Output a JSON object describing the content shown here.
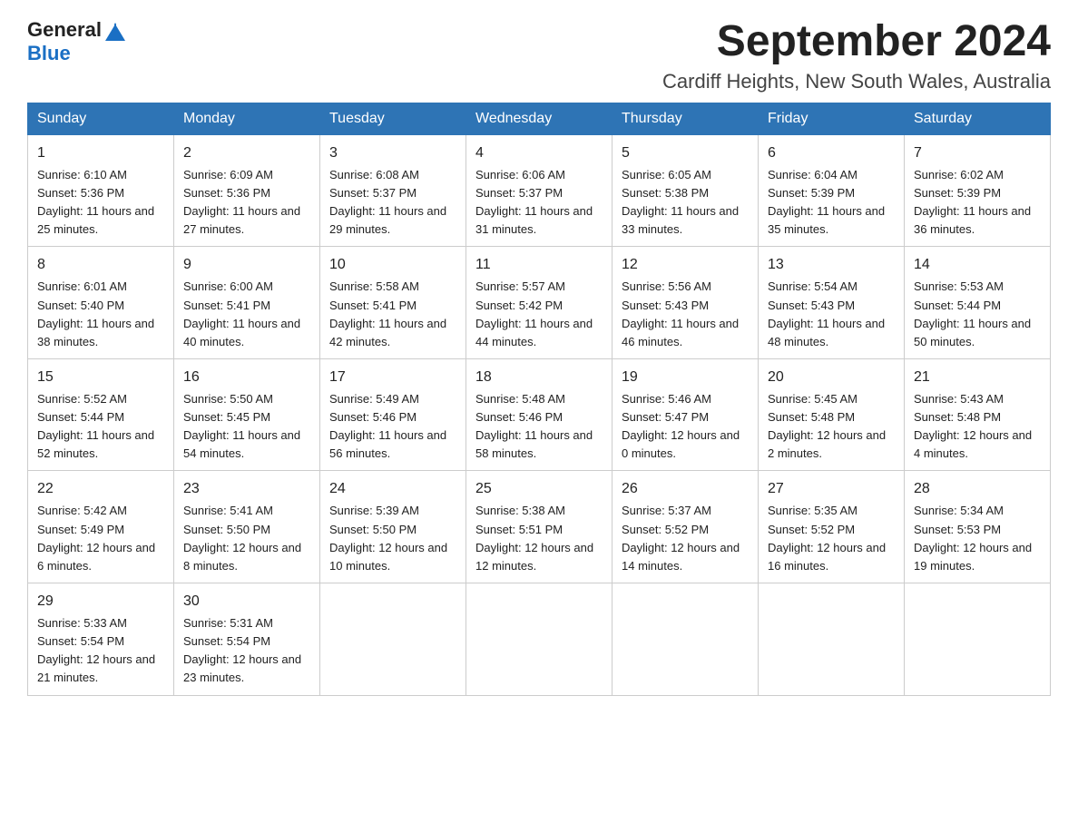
{
  "header": {
    "logo": {
      "general": "General",
      "blue": "Blue"
    },
    "month_title": "September 2024",
    "location": "Cardiff Heights, New South Wales, Australia"
  },
  "calendar": {
    "days_of_week": [
      "Sunday",
      "Monday",
      "Tuesday",
      "Wednesday",
      "Thursday",
      "Friday",
      "Saturday"
    ],
    "weeks": [
      [
        {
          "day": 1,
          "sunrise": "6:10 AM",
          "sunset": "5:36 PM",
          "daylight": "11 hours and 25 minutes."
        },
        {
          "day": 2,
          "sunrise": "6:09 AM",
          "sunset": "5:36 PM",
          "daylight": "11 hours and 27 minutes."
        },
        {
          "day": 3,
          "sunrise": "6:08 AM",
          "sunset": "5:37 PM",
          "daylight": "11 hours and 29 minutes."
        },
        {
          "day": 4,
          "sunrise": "6:06 AM",
          "sunset": "5:37 PM",
          "daylight": "11 hours and 31 minutes."
        },
        {
          "day": 5,
          "sunrise": "6:05 AM",
          "sunset": "5:38 PM",
          "daylight": "11 hours and 33 minutes."
        },
        {
          "day": 6,
          "sunrise": "6:04 AM",
          "sunset": "5:39 PM",
          "daylight": "11 hours and 35 minutes."
        },
        {
          "day": 7,
          "sunrise": "6:02 AM",
          "sunset": "5:39 PM",
          "daylight": "11 hours and 36 minutes."
        }
      ],
      [
        {
          "day": 8,
          "sunrise": "6:01 AM",
          "sunset": "5:40 PM",
          "daylight": "11 hours and 38 minutes."
        },
        {
          "day": 9,
          "sunrise": "6:00 AM",
          "sunset": "5:41 PM",
          "daylight": "11 hours and 40 minutes."
        },
        {
          "day": 10,
          "sunrise": "5:58 AM",
          "sunset": "5:41 PM",
          "daylight": "11 hours and 42 minutes."
        },
        {
          "day": 11,
          "sunrise": "5:57 AM",
          "sunset": "5:42 PM",
          "daylight": "11 hours and 44 minutes."
        },
        {
          "day": 12,
          "sunrise": "5:56 AM",
          "sunset": "5:43 PM",
          "daylight": "11 hours and 46 minutes."
        },
        {
          "day": 13,
          "sunrise": "5:54 AM",
          "sunset": "5:43 PM",
          "daylight": "11 hours and 48 minutes."
        },
        {
          "day": 14,
          "sunrise": "5:53 AM",
          "sunset": "5:44 PM",
          "daylight": "11 hours and 50 minutes."
        }
      ],
      [
        {
          "day": 15,
          "sunrise": "5:52 AM",
          "sunset": "5:44 PM",
          "daylight": "11 hours and 52 minutes."
        },
        {
          "day": 16,
          "sunrise": "5:50 AM",
          "sunset": "5:45 PM",
          "daylight": "11 hours and 54 minutes."
        },
        {
          "day": 17,
          "sunrise": "5:49 AM",
          "sunset": "5:46 PM",
          "daylight": "11 hours and 56 minutes."
        },
        {
          "day": 18,
          "sunrise": "5:48 AM",
          "sunset": "5:46 PM",
          "daylight": "11 hours and 58 minutes."
        },
        {
          "day": 19,
          "sunrise": "5:46 AM",
          "sunset": "5:47 PM",
          "daylight": "12 hours and 0 minutes."
        },
        {
          "day": 20,
          "sunrise": "5:45 AM",
          "sunset": "5:48 PM",
          "daylight": "12 hours and 2 minutes."
        },
        {
          "day": 21,
          "sunrise": "5:43 AM",
          "sunset": "5:48 PM",
          "daylight": "12 hours and 4 minutes."
        }
      ],
      [
        {
          "day": 22,
          "sunrise": "5:42 AM",
          "sunset": "5:49 PM",
          "daylight": "12 hours and 6 minutes."
        },
        {
          "day": 23,
          "sunrise": "5:41 AM",
          "sunset": "5:50 PM",
          "daylight": "12 hours and 8 minutes."
        },
        {
          "day": 24,
          "sunrise": "5:39 AM",
          "sunset": "5:50 PM",
          "daylight": "12 hours and 10 minutes."
        },
        {
          "day": 25,
          "sunrise": "5:38 AM",
          "sunset": "5:51 PM",
          "daylight": "12 hours and 12 minutes."
        },
        {
          "day": 26,
          "sunrise": "5:37 AM",
          "sunset": "5:52 PM",
          "daylight": "12 hours and 14 minutes."
        },
        {
          "day": 27,
          "sunrise": "5:35 AM",
          "sunset": "5:52 PM",
          "daylight": "12 hours and 16 minutes."
        },
        {
          "day": 28,
          "sunrise": "5:34 AM",
          "sunset": "5:53 PM",
          "daylight": "12 hours and 19 minutes."
        }
      ],
      [
        {
          "day": 29,
          "sunrise": "5:33 AM",
          "sunset": "5:54 PM",
          "daylight": "12 hours and 21 minutes."
        },
        {
          "day": 30,
          "sunrise": "5:31 AM",
          "sunset": "5:54 PM",
          "daylight": "12 hours and 23 minutes."
        },
        null,
        null,
        null,
        null,
        null
      ]
    ]
  }
}
